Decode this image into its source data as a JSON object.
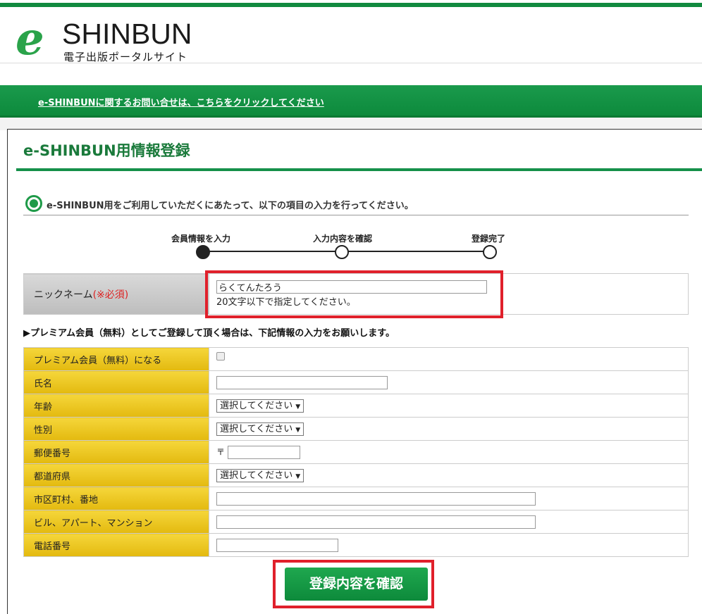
{
  "header": {
    "logo_e": "e",
    "logo_word": "SHINBUN",
    "logo_subtitle": "電子出版ポータルサイト"
  },
  "banner": {
    "contact_link": "e-SHINBUNに関するお問い合せは、こちらをクリックしてください"
  },
  "page": {
    "title": "e-SHINBUN用情報登録",
    "intro": "e-SHINBUN用をご利用していただくにあたって、以下の項目の入力を行ってください。"
  },
  "steps": [
    {
      "label": "会員情報を入力",
      "active": true
    },
    {
      "label": "入力内容を確認",
      "active": false
    },
    {
      "label": "登録完了",
      "active": false
    }
  ],
  "nickname": {
    "label": "ニックネーム",
    "required": "(※必須)",
    "value": "らくてんたろう",
    "hint": "20文字以下で指定してください。"
  },
  "premium_note": "▶プレミアム会員（無料）としてご登録して頂く場合は、下記情報の入力をお願いします。",
  "form": {
    "premium_label": "プレミアム会員（無料）になる",
    "name_label": "氏名",
    "age_label": "年齢",
    "age_select": "選択してください",
    "gender_label": "性別",
    "gender_select": "選択してください",
    "zip_label": "郵便番号",
    "zip_mark": "〒",
    "pref_label": "都道府県",
    "pref_select": "選択してください",
    "city_label": "市区町村、番地",
    "building_label": "ビル、アパート、マンション",
    "phone_label": "電話番号"
  },
  "confirm_button": "登録内容を確認",
  "colors": {
    "brand_green": "#128a3f",
    "highlight_red": "#e0202b",
    "label_gold": "#e3b90f"
  }
}
